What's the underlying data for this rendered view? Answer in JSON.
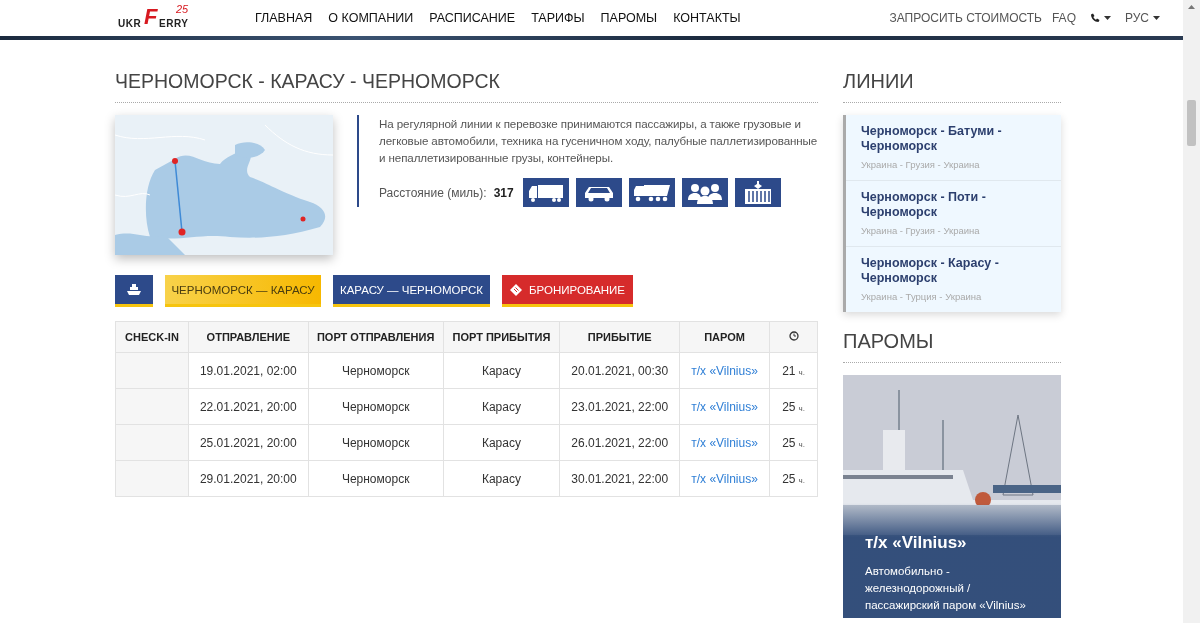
{
  "header": {
    "logo": {
      "left": "UKR",
      "mark": "F",
      "right": "ERRY",
      "badge": "25"
    },
    "nav": [
      {
        "label": "ГЛАВНАЯ"
      },
      {
        "label": "О КОМПАНИИ"
      },
      {
        "label": "РАСПИСАНИЕ"
      },
      {
        "label": "ТАРИФЫ"
      },
      {
        "label": "ПАРОМЫ"
      },
      {
        "label": "КОНТАКТЫ"
      }
    ],
    "utility": [
      {
        "kind": "link",
        "label": "ЗАПРОСИТЬ СТОИМОСТЬ"
      },
      {
        "kind": "link",
        "label": "FAQ"
      },
      {
        "kind": "phone"
      },
      {
        "kind": "menu",
        "label": "РУС"
      }
    ]
  },
  "route": {
    "title": "ЧЕРНОМОРСК - КАРАСУ - ЧЕРНОМОРСК",
    "description": "На регулярной линии к перевозке принимаются пассажиры, а также грузовые и легковые автомобили, техника на гусеничном ходу, палубные паллетизированные и непаллетизированные грузы, контейнеры.",
    "distance_label": "Расстояние (миль):",
    "distance": "317",
    "cargo": [
      {
        "kind": "truck"
      },
      {
        "kind": "car"
      },
      {
        "kind": "dumptruck"
      },
      {
        "kind": "people"
      },
      {
        "kind": "container"
      }
    ]
  },
  "tabs": [
    {
      "kind": "icon"
    },
    {
      "kind": "direction",
      "label": "ЧЕРНОМОРСК — КАРАСУ",
      "selected": true
    },
    {
      "kind": "direction",
      "label": "КАРАСУ — ЧЕРНОМОРСК",
      "selected": false
    },
    {
      "kind": "booking",
      "label": "БРОНИРОВАНИЕ"
    }
  ],
  "table": {
    "columns": [
      "CHECK-IN",
      "ОТПРАВЛЕНИЕ",
      "ПОРТ ОТПРАВЛЕНИЯ",
      "ПОРТ ПРИБЫТИЯ",
      "ПРИБЫТИЕ",
      "ПАРОМ"
    ],
    "rows": [
      {
        "departure": "19.01.2021, 02:00",
        "from": "Черноморск",
        "to": "Карасу",
        "arrival": "20.01.2021, 00:30",
        "ferry": "т/х «Vilnius»",
        "duration": "21",
        "unit": "ч."
      },
      {
        "departure": "22.01.2021, 20:00",
        "from": "Черноморск",
        "to": "Карасу",
        "arrival": "23.01.2021, 22:00",
        "ferry": "т/х «Vilnius»",
        "duration": "25",
        "unit": "ч."
      },
      {
        "departure": "25.01.2021, 20:00",
        "from": "Черноморск",
        "to": "Карасу",
        "arrival": "26.01.2021, 22:00",
        "ferry": "т/х «Vilnius»",
        "duration": "25",
        "unit": "ч."
      },
      {
        "departure": "29.01.2021, 20:00",
        "from": "Черноморск",
        "to": "Карасу",
        "arrival": "30.01.2021, 22:00",
        "ferry": "т/х «Vilnius»",
        "duration": "25",
        "unit": "ч."
      }
    ]
  },
  "sidebar": {
    "lines_title": "ЛИНИИ",
    "lines": [
      {
        "name": "Черноморск - Батуми - Черноморск",
        "countries": "Украина - Грузия - Украина"
      },
      {
        "name": "Черноморск - Поти - Черноморск",
        "countries": "Украина - Грузия - Украина"
      },
      {
        "name": "Черноморск - Карасу - Черноморск",
        "countries": "Украина - Турция - Украина"
      }
    ],
    "ferries_title": "ПАРОМЫ",
    "ferry": {
      "kind": "picture",
      "name": "т/х «Vilnius»",
      "description": "Автомобильно - железнодорожный / пассажирский паром «Vilnius»"
    }
  }
}
